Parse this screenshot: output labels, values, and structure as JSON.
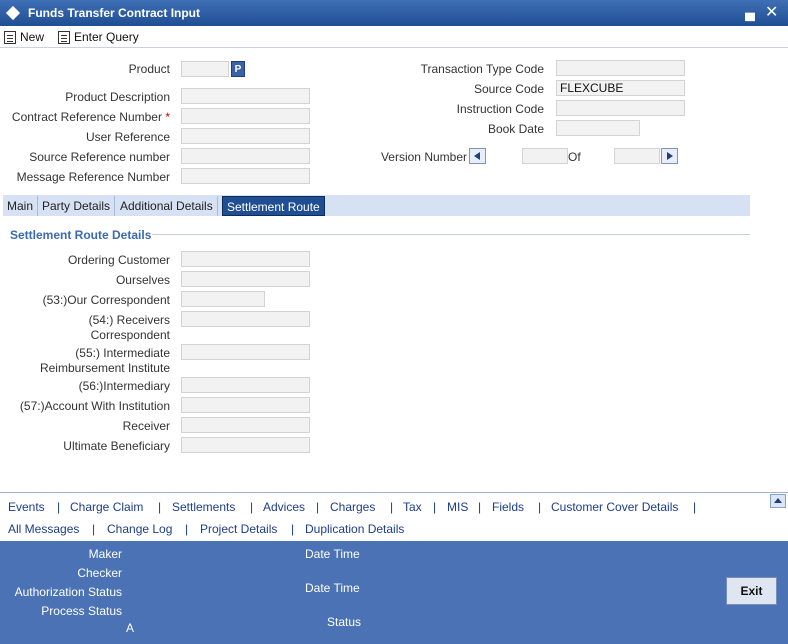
{
  "window": {
    "title": "Funds Transfer Contract Input",
    "minimize_glyph": "▄",
    "close_glyph": "✕"
  },
  "toolbar": {
    "new_label": "New",
    "enter_query_label": "Enter Query"
  },
  "header_left": {
    "product_label": "Product",
    "product_button_label": "P",
    "product_description_label": "Product Description",
    "contract_reference_label": "Contract Reference Number",
    "required_marker": "*",
    "user_reference_label": "User Reference",
    "source_reference_label": "Source Reference number",
    "message_reference_label": "Message Reference Number"
  },
  "header_right": {
    "transaction_type_label": "Transaction Type Code",
    "source_code_label": "Source Code",
    "source_code_value": "FLEXCUBE",
    "instruction_code_label": "Instruction Code",
    "book_date_label": "Book Date",
    "version_number_label": "Version Number",
    "of_label": "Of"
  },
  "tabs": [
    {
      "label": "Main"
    },
    {
      "label": "Party Details"
    },
    {
      "label": "Additional Details"
    },
    {
      "label": "Settlement Route",
      "active": true
    }
  ],
  "settlement": {
    "section_title": "Settlement Route Details",
    "ordering_customer": "Ordering Customer",
    "ourselves": "Ourselves",
    "our_correspondent": "(53:)Our Correspondent",
    "receivers_correspondent_1": "(54:) Receivers",
    "receivers_correspondent_2": "Correspondent",
    "intermediate_reimb_1": "(55:) Intermediate",
    "intermediate_reimb_2": "Reimbursement Institute",
    "intermediary": "(56:)Intermediary",
    "account_with_institution": "(57:)Account With Institution",
    "receiver": "Receiver",
    "ultimate_beneficiary": "Ultimate Beneficiary"
  },
  "links_row1": [
    "Events",
    "Charge Claim",
    "Settlements",
    "Advices",
    "Charges",
    "Tax",
    "MIS",
    "Fields",
    "Customer Cover Details"
  ],
  "links_row2": [
    "All Messages",
    "Change Log",
    "Project Details",
    "Duplication Details"
  ],
  "link_separator": "|",
  "footer": {
    "maker_label": "Maker",
    "checker_label": "Checker",
    "authorization_status_label": "Authorization Status",
    "process_status_label": "Process Status",
    "process_status_value": "A",
    "date_time_label_1": "Date Time",
    "date_time_label_2": "Date Time",
    "status_label": "Status",
    "exit_label": "Exit"
  },
  "colors": {
    "title_bar": "#1f4e93",
    "active_tab": "#1f4e93",
    "footer": "#4a72b4",
    "link": "#1c3d8a",
    "section_title": "#3a6ab0"
  }
}
